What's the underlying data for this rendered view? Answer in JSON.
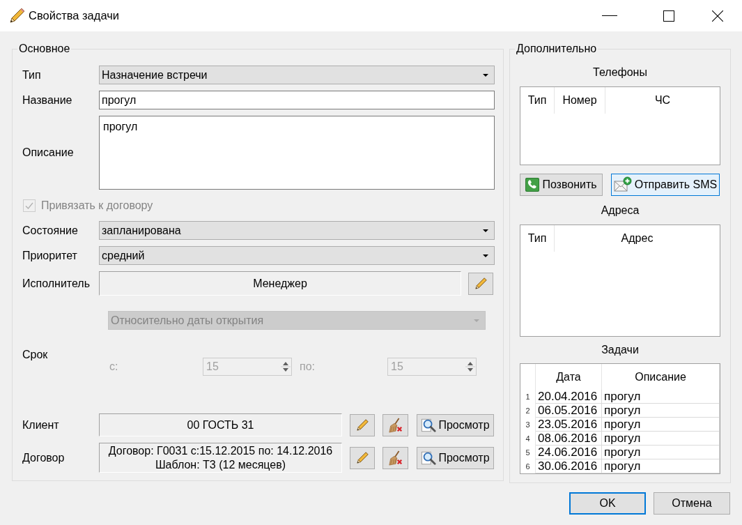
{
  "window": {
    "title": "Свойства задачи"
  },
  "main": {
    "title": "Основное",
    "fields": [
      {
        "kind": "combo",
        "label": "Тип",
        "value": "Назначение встречи",
        "disabled": false
      },
      {
        "kind": "input",
        "label": "Название",
        "value": "прогул",
        "disabled": false
      },
      {
        "kind": "textarea",
        "label": "Описание",
        "value": "прогул",
        "disabled": false
      },
      {
        "kind": "checkbox",
        "label": "Привязать к договору",
        "checked": true,
        "disabled": true
      },
      {
        "kind": "combo",
        "label": "Состояние",
        "value": "запланирована",
        "disabled": false
      },
      {
        "kind": "combo",
        "label": "Приоритет",
        "value": "средний",
        "disabled": false
      },
      {
        "kind": "picker",
        "label": "Исполнитель",
        "value": "Менеджер",
        "disabled": false
      },
      {
        "kind": "deadline",
        "label": "Срок",
        "mode": "Относительно даты открытия",
        "from_label": "с:",
        "from": "15",
        "to_label": "по:",
        "to": "15",
        "disabled": true
      },
      {
        "kind": "link",
        "label": "Клиент",
        "lines": [
          "00 ГОСТЬ 31"
        ],
        "view_label": "Просмотр",
        "disabled": false
      },
      {
        "kind": "link",
        "label": "Договор",
        "lines": [
          "Договор: Г0031 с:15.12.2015 по: 14.12.2016",
          "Шаблон: Т3 (12 месяцев)"
        ],
        "view_label": "Просмотр",
        "disabled": false
      }
    ]
  },
  "extra": {
    "title": "Дополнительно",
    "phones": {
      "title": "Телефоны",
      "columns": [
        "Тип",
        "Номер",
        "ЧС"
      ]
    },
    "phone_buttons": [
      {
        "kind": "call",
        "label": "Позвонить",
        "hovered": false
      },
      {
        "kind": "sms",
        "label": "Отправить SMS",
        "hovered": true
      }
    ],
    "addresses": {
      "title": "Адреса",
      "columns": [
        "Тип",
        "Адрес"
      ]
    },
    "tasks": {
      "title": "Задачи",
      "columns": [
        "Дата",
        "Описание"
      ],
      "rows": [
        {
          "number": "1",
          "date": "20.04.2016",
          "description": "прогул"
        },
        {
          "number": "2",
          "date": "06.05.2016",
          "description": "прогул"
        },
        {
          "number": "3",
          "date": "23.05.2016",
          "description": "прогул"
        },
        {
          "number": "4",
          "date": "08.06.2016",
          "description": "прогул"
        },
        {
          "number": "5",
          "date": "24.06.2016",
          "description": "прогул"
        },
        {
          "number": "6",
          "date": "30.06.2016",
          "description": "прогул"
        }
      ]
    }
  },
  "buttons": [
    {
      "label": "OK",
      "default": true
    },
    {
      "label": "Отмена",
      "default": false
    }
  ]
}
